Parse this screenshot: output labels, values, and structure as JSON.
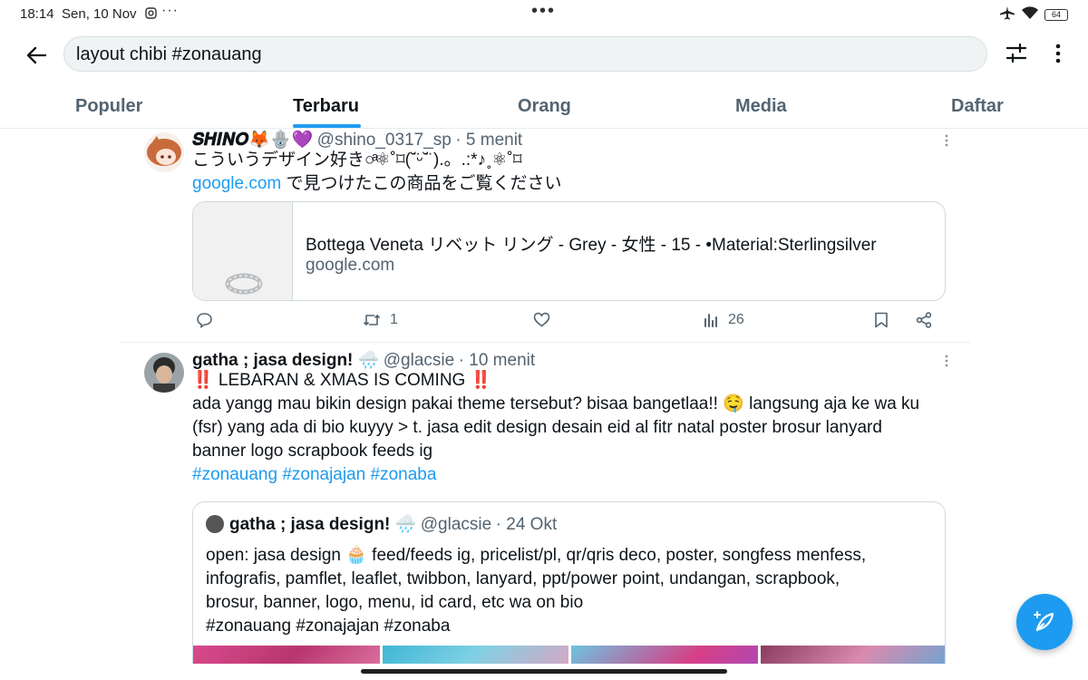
{
  "status_bar": {
    "time": "18:14",
    "date": "Sen, 10 Nov",
    "overflow": "···",
    "center_dots": "•••",
    "battery": "64"
  },
  "search": {
    "query": "layout chibi #zonauang"
  },
  "tabs": [
    {
      "label": "Populer"
    },
    {
      "label": "Terbaru"
    },
    {
      "label": "Orang"
    },
    {
      "label": "Media"
    },
    {
      "label": "Daftar"
    }
  ],
  "active_tab": "Terbaru",
  "tweets": [
    {
      "display_name": "𝑺𝑯𝑰𝑵𝑶🦊🪬💜",
      "handle": "@shino_0317_sp",
      "time": "· 5 menit",
      "text_line1": "こういうデザイン好き○ͣ⚛︎˚⌑(˘̈ᵕ˘̈ ).。.:*♪˳⚛︎˚⌑",
      "link_text": "google.com",
      "text_line2_rest": " で見つけたこの商品をご覧ください",
      "card": {
        "title": "Bottega Veneta リベット リング - Grey - 女性 - 15 - •Material:Sterlingsilver",
        "domain": "google.com"
      },
      "actions": {
        "reply": "",
        "retweets": "1",
        "likes": "",
        "views": "26"
      }
    },
    {
      "display_name": "gatha ; jasa design! 🌧️",
      "handle": "@glacsie",
      "time": "· 10 menit",
      "headline": "‼️ LEBARAN & XMAS IS COMING ‼️",
      "text_lines": [
        "ada yangg mau bikin design pakai theme tersebut? bisaa bangetlaa!! 🤤 langsung aja ke wa ku",
        "(fsr) yang ada di bio kuyyy > t. jasa edit design desain eid al fitr natal poster brosur lanyard",
        "banner logo scrapbook feeds ig"
      ],
      "hashtags": "#zonauang #zonajajan #zonaba",
      "quote": {
        "display_name": "gatha ; jasa design! 🌧️",
        "handle": "@glacsie",
        "time": "· 24 Okt",
        "text_lines": [
          "open: jasa design 🧁 feed/feeds ig, pricelist/pl, qr/qris deco, poster, songfess menfess,",
          "infografis, pamflet, leaflet, twibbon, lanyard, ppt/power point, undangan, scrapbook,",
          "brosur, banner, logo, menu, id card, etc wa on bio",
          "#zonauang #zonajajan #zonaba"
        ]
      }
    }
  ],
  "colors": {
    "accent": "#1d9bf0",
    "text": "#0f1419",
    "secondary": "#536471",
    "border": "#cfd9de"
  }
}
